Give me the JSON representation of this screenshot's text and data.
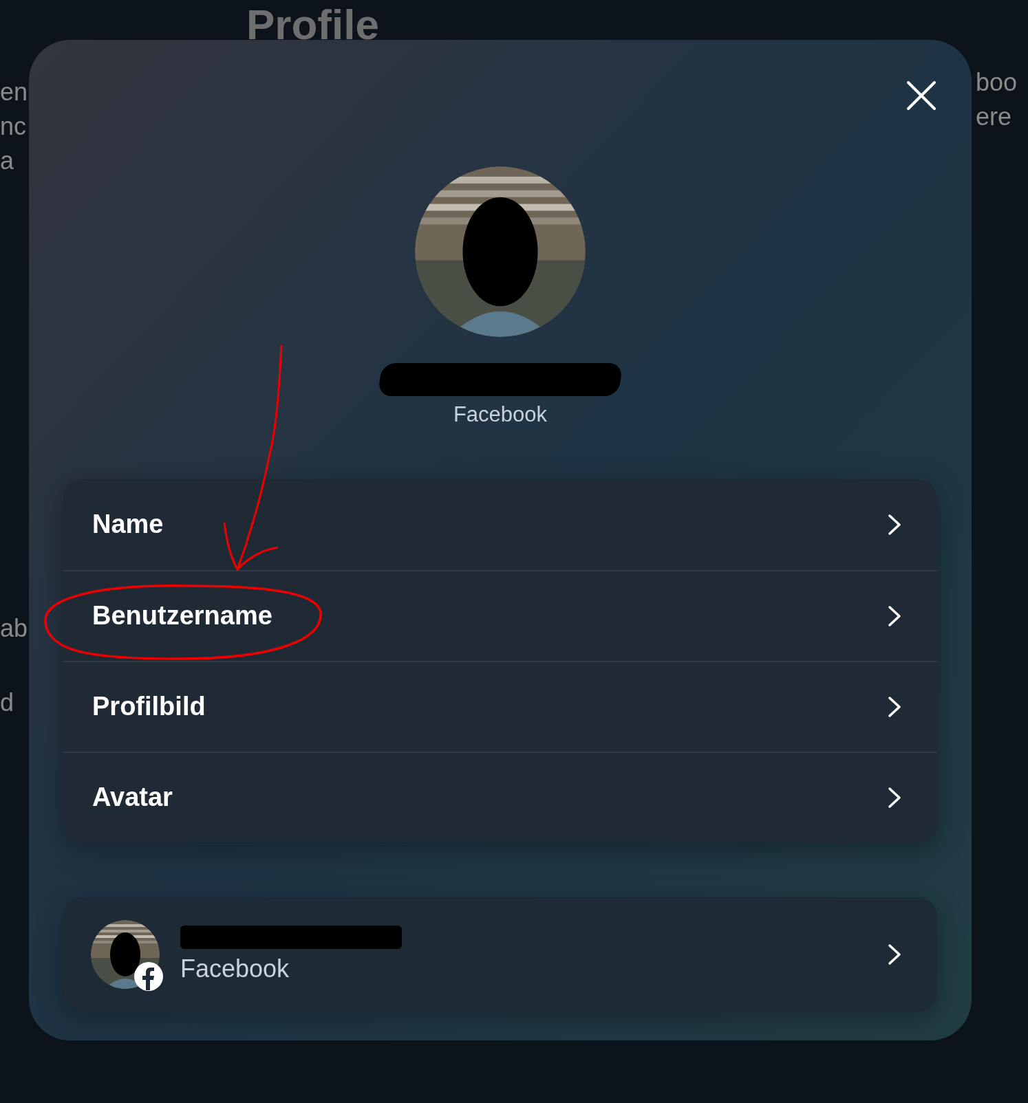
{
  "page": {
    "title": "Profile",
    "left_fragments": [
      "en",
      "nc",
      "a",
      "ab",
      "d"
    ],
    "right_fragments": [
      "boo",
      "ere"
    ]
  },
  "dialog": {
    "profile": {
      "kind": "picture",
      "subtitle": "Facebook"
    },
    "menu": [
      {
        "label": "Name"
      },
      {
        "label": "Benutzername"
      },
      {
        "label": "Profilbild"
      },
      {
        "label": "Avatar"
      }
    ],
    "account": {
      "kind": "picture",
      "subtitle": "Facebook"
    }
  }
}
